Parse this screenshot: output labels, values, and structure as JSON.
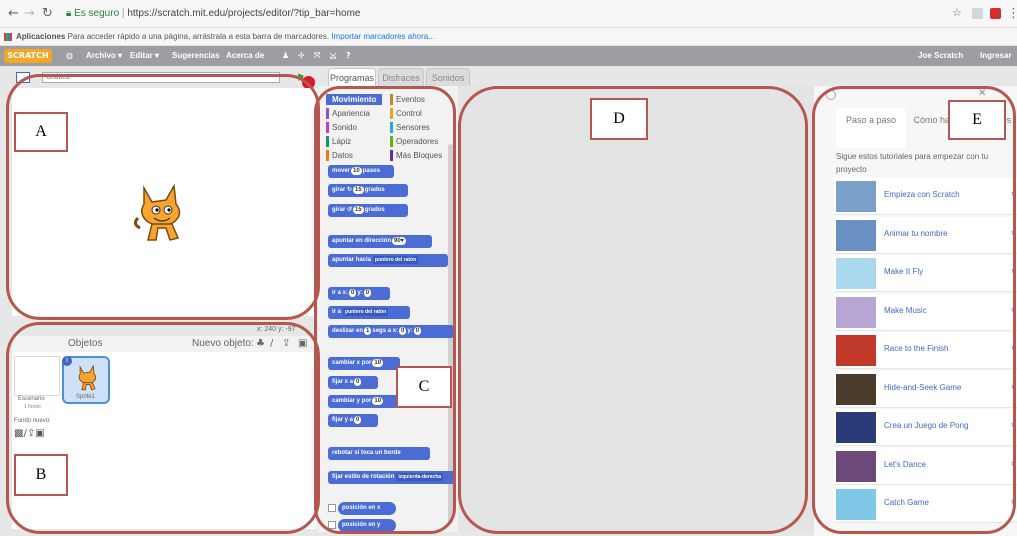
{
  "browser": {
    "secure_label": "Es seguro",
    "url": "https://scratch.mit.edu/projects/editor/?tip_bar=home",
    "bookmarks_apps": "Aplicaciones",
    "bookmarks_text": "Para acceder rápido a una página, arrástrala a esta barra de marcadores.",
    "bookmarks_link": "Importar marcadores ahora..."
  },
  "menubar": {
    "logo": "SCRATCH",
    "file": "Archivo ▾",
    "edit": "Editar ▾",
    "tips": "Sugerencias",
    "about": "Acerca de",
    "user": "Joe Scratch",
    "signin": "Ingresar"
  },
  "stage": {
    "project_title": "Untitled",
    "coords": "x: 240  y: -97"
  },
  "sprites": {
    "header": "Objetos",
    "new_sprite": "Nuevo objeto:",
    "stage_label": "Escenario",
    "stage_sub": "1 fondo",
    "new_backdrop": "Fondo nuevo:",
    "sprite1": "Sprite1"
  },
  "tabs": [
    "Programas",
    "Disfraces",
    "Sonidos"
  ],
  "categories": [
    {
      "name": "Movimiento",
      "color": "#4a6cd4"
    },
    {
      "name": "Eventos",
      "color": "#c88330"
    },
    {
      "name": "Apariencia",
      "color": "#8a55d7"
    },
    {
      "name": "Control",
      "color": "#e1a91a"
    },
    {
      "name": "Sonido",
      "color": "#bb42c3"
    },
    {
      "name": "Sensores",
      "color": "#2ca5e2"
    },
    {
      "name": "Lápiz",
      "color": "#0e9a6c"
    },
    {
      "name": "Operadores",
      "color": "#5cb712"
    },
    {
      "name": "Datos",
      "color": "#ee7d16"
    },
    {
      "name": "Más Bloques",
      "color": "#632d99"
    }
  ],
  "blocks": {
    "b1": {
      "t": "mover",
      "v": "10",
      "u": "pasos"
    },
    "b2": {
      "t": "girar ↻",
      "v": "15",
      "u": "grados"
    },
    "b3": {
      "t": "girar ↺",
      "v": "15",
      "u": "grados"
    },
    "b4": {
      "t": "apuntar en dirección",
      "v": "90▾"
    },
    "b5": {
      "t": "apuntar hacia",
      "d": "puntero del ratón"
    },
    "b6": {
      "t": "ir a x:",
      "v": "0",
      "t2": "y:",
      "v2": "0"
    },
    "b7": {
      "t": "ir a",
      "d": "puntero del ratón"
    },
    "b8": {
      "t": "deslizar en",
      "v": "1",
      "t2": "segs a x:",
      "v2": "0",
      "t3": "y:",
      "v3": "0"
    },
    "b9": {
      "t": "cambiar x por",
      "v": "10"
    },
    "b10": {
      "t": "fijar x a",
      "v": "0"
    },
    "b11": {
      "t": "cambiar y por",
      "v": "10"
    },
    "b12": {
      "t": "fijar y a",
      "v": "0"
    },
    "b13": {
      "t": "rebotar si toca un borde"
    },
    "b14": {
      "t": "fijar estilo de rotación",
      "d": "izquierda-derecha"
    },
    "b15": {
      "t": "posición en x"
    },
    "b16": {
      "t": "posición en y"
    }
  },
  "tips": {
    "tab1": "Paso a paso",
    "tab2": "Cómo hacer",
    "tab3": "Bloques",
    "intro": "Sigue estos tutoriales para empezar con tu proyecto",
    "tutorials": [
      {
        "name": "Empieza con Scratch",
        "color": "#7aa0c9"
      },
      {
        "name": "Animar tu nombre",
        "color": "#6a8fc2"
      },
      {
        "name": "Make It Fly",
        "color": "#a9d8ef"
      },
      {
        "name": "Make Music",
        "color": "#b7a5d6"
      },
      {
        "name": "Race to the Finish",
        "color": "#c0392b"
      },
      {
        "name": "Hide-and-Seek Game",
        "color": "#4b3c2c"
      },
      {
        "name": "Crea un Juego de Pong",
        "color": "#2b3b7a"
      },
      {
        "name": "Let's Dance",
        "color": "#6b4a7a"
      },
      {
        "name": "Catch Game",
        "color": "#7fc8e8"
      }
    ]
  },
  "annotations": {
    "A": "A",
    "B": "B",
    "C": "C",
    "D": "D",
    "E": "E"
  }
}
